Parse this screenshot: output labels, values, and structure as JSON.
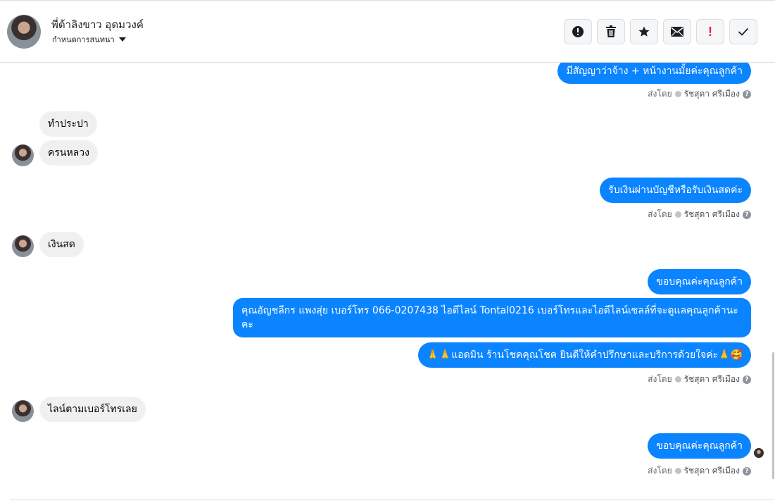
{
  "header": {
    "contact_name": "พี่ต้าลิงขาว อุดมวงค์",
    "assign_label": "กำหนดการสนทนา",
    "actions": [
      {
        "icon": "alert-circle-icon",
        "label": ""
      },
      {
        "icon": "trash-icon",
        "label": ""
      },
      {
        "icon": "star-icon",
        "label": ""
      },
      {
        "icon": "envelope-icon",
        "label": ""
      },
      {
        "icon": "exclamation-icon",
        "label": "!"
      },
      {
        "icon": "check-icon",
        "label": ""
      }
    ]
  },
  "sent_by": {
    "prefix": "ส่งโดย",
    "agent": "รัชสุดา ศรีเมือง",
    "help": "?"
  },
  "messages": [
    {
      "dir": "out",
      "text": "มีสัญญาว่าจ้าง +  หน้างานมั้ยค่ะคุณลูกค้า"
    },
    {
      "dir": "in",
      "text": "ทำประปา"
    },
    {
      "dir": "in",
      "text": "ครนหลวง"
    },
    {
      "dir": "out",
      "text": "รับเงินผ่านบัญชีหรือรับเงินสดค่ะ"
    },
    {
      "dir": "in",
      "text": "เงินสด"
    },
    {
      "dir": "out",
      "text": "ขอบคุณค่ะคุณลูกค้า"
    },
    {
      "dir": "out",
      "text": "คุณอัญชลีกร แพงสุ่ย      เบอร์โทร 066-0207438 ไอดีไลน์ Tontal0216  เบอร์โทรและไอดีไลน์เซลล์ที่จะดูแลคุณลูกค้านะคะ"
    },
    {
      "dir": "out",
      "text": "🙏🙏แอดมิน ร้านโชคคุณโชค ยินดีให้คำปรึกษาและบริการด้วยใจค่ะ🙏🥰"
    },
    {
      "dir": "in",
      "text": "ไลน์ตามเบอร์โทรเลย"
    },
    {
      "dir": "out",
      "text": "ขอบคุณค่ะคุณลูกค้า"
    }
  ],
  "colors": {
    "outgoing_bubble": "#0b84ff",
    "incoming_bubble": "#f0f0f0",
    "alert_red": "#e41e3f"
  }
}
